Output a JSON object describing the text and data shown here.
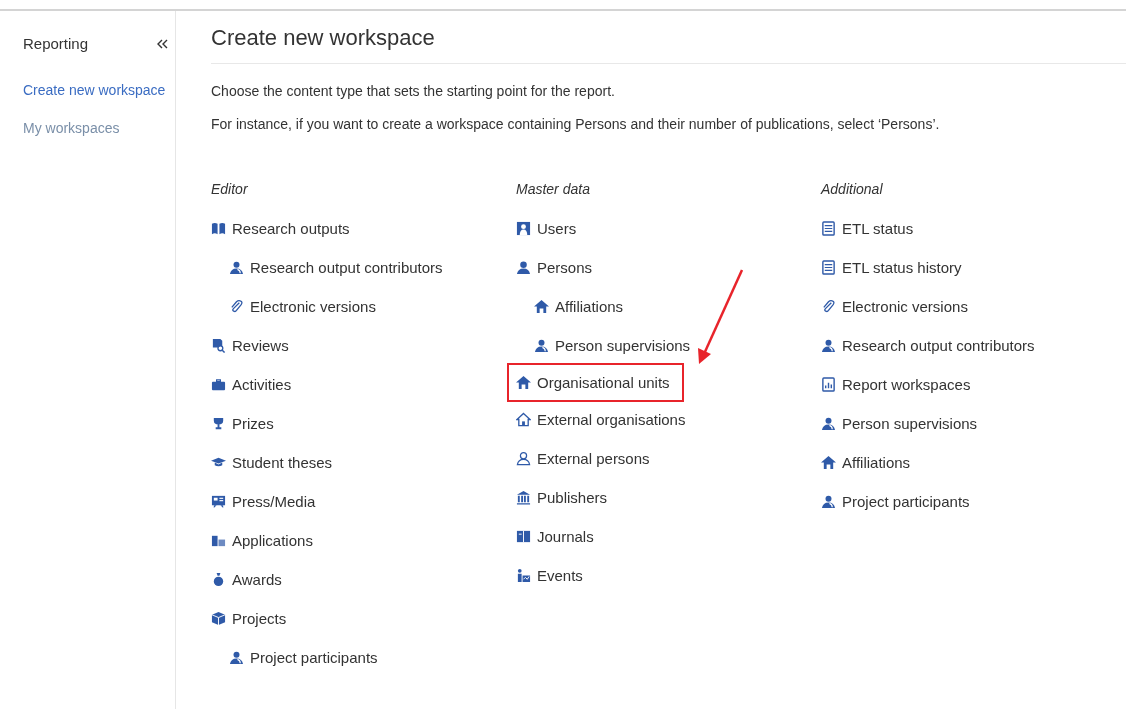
{
  "sidebar": {
    "title": "Reporting",
    "items": [
      {
        "label": "Create new workspace",
        "selected": true
      },
      {
        "label": "My workspaces",
        "selected": false
      }
    ]
  },
  "main": {
    "title": "Create new workspace",
    "intro": [
      "Choose the content type that sets the starting point for the report.",
      "For instance, if you want to create a workspace containing Persons and their number of publications, select ‘Persons’."
    ],
    "columns": [
      {
        "heading": "Editor",
        "items": [
          {
            "label": "Research outputs",
            "kind": "book",
            "highlighted": false,
            "children": [
              {
                "label": "Research output contributors",
                "kind": "contributor",
                "highlighted": false
              },
              {
                "label": "Electronic versions",
                "kind": "attachment",
                "highlighted": false
              }
            ]
          },
          {
            "label": "Reviews",
            "kind": "review",
            "highlighted": false
          },
          {
            "label": "Activities",
            "kind": "briefcase",
            "highlighted": false
          },
          {
            "label": "Prizes",
            "kind": "trophy",
            "highlighted": false
          },
          {
            "label": "Student theses",
            "kind": "graduation",
            "highlighted": false
          },
          {
            "label": "Press/Media",
            "kind": "press",
            "highlighted": false
          },
          {
            "label": "Applications",
            "kind": "application",
            "highlighted": false
          },
          {
            "label": "Awards",
            "kind": "award",
            "highlighted": false
          },
          {
            "label": "Projects",
            "kind": "project",
            "highlighted": false,
            "children": [
              {
                "label": "Project participants",
                "kind": "contributor",
                "highlighted": false
              }
            ]
          }
        ]
      },
      {
        "heading": "Master data",
        "items": [
          {
            "label": "Users",
            "kind": "user",
            "highlighted": false
          },
          {
            "label": "Persons",
            "kind": "person",
            "highlighted": false,
            "children": [
              {
                "label": "Affiliations",
                "kind": "home",
                "highlighted": false
              },
              {
                "label": "Person supervisions",
                "kind": "contributor",
                "highlighted": false
              }
            ]
          },
          {
            "label": "Organisational units",
            "kind": "home",
            "highlighted": true
          },
          {
            "label": "External organisations",
            "kind": "home-outline",
            "highlighted": false
          },
          {
            "label": "External persons",
            "kind": "person-outline",
            "highlighted": false
          },
          {
            "label": "Publishers",
            "kind": "building",
            "highlighted": false
          },
          {
            "label": "Journals",
            "kind": "journal",
            "highlighted": false
          },
          {
            "label": "Events",
            "kind": "event",
            "highlighted": false
          }
        ]
      },
      {
        "heading": "Additional",
        "items": [
          {
            "label": "ETL status",
            "kind": "list",
            "highlighted": false
          },
          {
            "label": "ETL status history",
            "kind": "list",
            "highlighted": false
          },
          {
            "label": "Electronic versions",
            "kind": "attachment",
            "highlighted": false
          },
          {
            "label": "Research output contributors",
            "kind": "contributor",
            "highlighted": false
          },
          {
            "label": "Report workspaces",
            "kind": "report",
            "highlighted": false
          },
          {
            "label": "Person supervisions",
            "kind": "contributor",
            "highlighted": false
          },
          {
            "label": "Affiliations",
            "kind": "home",
            "highlighted": false
          },
          {
            "label": "Project participants",
            "kind": "contributor",
            "highlighted": false
          }
        ]
      }
    ]
  }
}
